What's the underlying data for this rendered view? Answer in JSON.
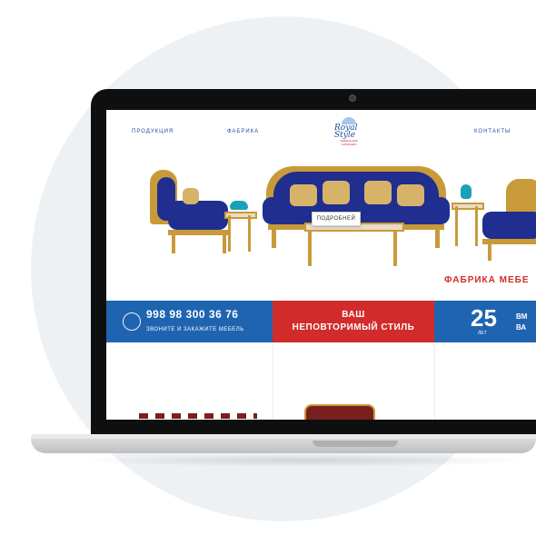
{
  "nav": {
    "links": [
      "ПРОДУКЦИЯ",
      "ФАБРИКА",
      "КОНТАКТЫ"
    ]
  },
  "logo": {
    "name": "Royal Style",
    "tagline": "МЕБЕЛЬ ДЛЯ ГАРМОНИИ"
  },
  "hero": {
    "button_label": "ПОДРОБНЕЙ",
    "title": "ФАБРИКА МЕБЕ"
  },
  "band": {
    "phone": "998 98 300 36 76",
    "phone_caption": "ЗВОНИТЕ И ЗАКАЖИТЕ МЕБЕЛЬ",
    "slogan_line1": "ВАШ",
    "slogan_line2": "НЕПОВТОРИМЫЙ СТИЛЬ",
    "years_number": "25",
    "years_label": "ЛЕТ",
    "side_line1": "ВМ",
    "side_line2": "ВА"
  },
  "colors": {
    "brand_blue": "#1f64b0",
    "brand_red": "#d22b2b",
    "upholstery_blue": "#1f2e8f",
    "gold": "#c99a3a"
  }
}
